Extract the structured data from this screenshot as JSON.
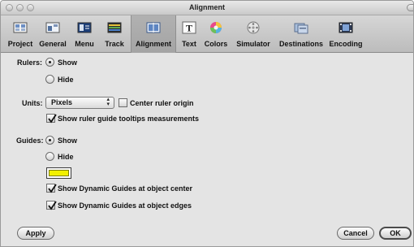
{
  "window": {
    "title": "Alignment"
  },
  "toolbar": {
    "items": [
      {
        "label": "Project",
        "icon": "project-icon"
      },
      {
        "label": "General",
        "icon": "general-icon"
      },
      {
        "label": "Menu",
        "icon": "menu-icon"
      },
      {
        "label": "Track",
        "icon": "track-icon"
      },
      {
        "label": "Alignment",
        "icon": "alignment-icon",
        "selected": true
      },
      {
        "label": "Text",
        "icon": "text-icon"
      },
      {
        "label": "Colors",
        "icon": "colors-icon"
      },
      {
        "label": "Simulator",
        "icon": "simulator-icon"
      },
      {
        "label": "Destinations",
        "icon": "destinations-icon"
      },
      {
        "label": "Encoding",
        "icon": "encoding-icon"
      }
    ]
  },
  "rulers": {
    "label": "Rulers:",
    "show_label": "Show",
    "hide_label": "Hide",
    "selected": "Show"
  },
  "units": {
    "label": "Units:",
    "value": "Pixels",
    "center_origin_label": "Center ruler origin",
    "center_origin_checked": false,
    "tooltips_label": "Show ruler guide tooltips measurements",
    "tooltips_checked": true
  },
  "guides": {
    "label": "Guides:",
    "show_label": "Show",
    "hide_label": "Hide",
    "selected": "Show",
    "color": "#f2f000",
    "center_label": "Show Dynamic Guides at object center",
    "center_checked": true,
    "edges_label": "Show Dynamic Guides at object edges",
    "edges_checked": true
  },
  "footer": {
    "apply_label": "Apply",
    "cancel_label": "Cancel",
    "ok_label": "OK"
  }
}
